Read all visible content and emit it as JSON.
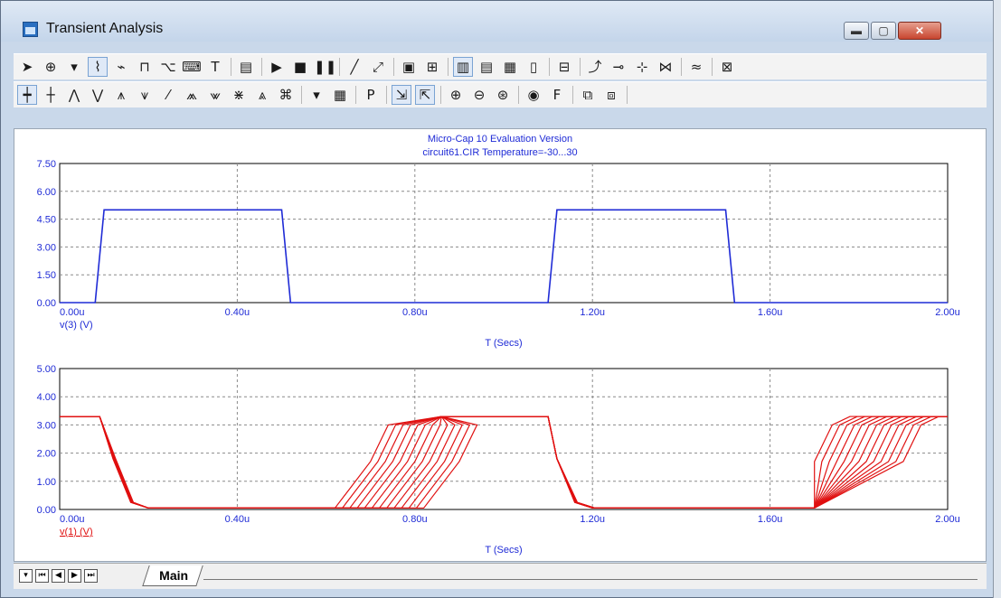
{
  "window": {
    "title": "Transient Analysis",
    "controls": {
      "minimize": "▬",
      "maximize": "▢",
      "close": "✕"
    }
  },
  "toolbar1": [
    {
      "name": "select-arrow-icon",
      "glyph": "➤"
    },
    {
      "name": "component-icon",
      "glyph": "⊕"
    },
    {
      "name": "dropdown-icon",
      "glyph": "▾"
    },
    {
      "name": "analysis-icon",
      "glyph": "⌇"
    },
    {
      "name": "wire-icon",
      "glyph": "⌁"
    },
    {
      "name": "scope-icon",
      "glyph": "⊓"
    },
    {
      "name": "probe-icon",
      "glyph": "⌥"
    },
    {
      "name": "rename-icon",
      "glyph": "⌨"
    },
    {
      "name": "text-tool-icon",
      "glyph": "T"
    },
    {
      "name": "properties-icon",
      "glyph": "▤"
    },
    {
      "name": "run-icon",
      "glyph": "▶"
    },
    {
      "name": "stop-icon",
      "glyph": "■"
    },
    {
      "name": "pause-icon",
      "glyph": "❚❚"
    },
    {
      "name": "line-icon",
      "glyph": "╱"
    },
    {
      "name": "diagonal-icon",
      "glyph": "⤢"
    },
    {
      "name": "box-icon",
      "glyph": "▣"
    },
    {
      "name": "grid-icon",
      "glyph": "⊞"
    },
    {
      "name": "vertical-bars-icon",
      "glyph": "▥"
    },
    {
      "name": "horizontal-bars-icon",
      "glyph": "▤"
    },
    {
      "name": "panel-icon",
      "glyph": "▦"
    },
    {
      "name": "columns-icon",
      "glyph": "▯"
    },
    {
      "name": "split-icon",
      "glyph": "⊟"
    },
    {
      "name": "curve-icon",
      "glyph": "⤴"
    },
    {
      "name": "cursor-left-icon",
      "glyph": "⊸"
    },
    {
      "name": "cursor-right-icon",
      "glyph": "⊹"
    },
    {
      "name": "cursor-both-icon",
      "glyph": "⋈"
    },
    {
      "name": "wave-icon",
      "glyph": "≈"
    },
    {
      "name": "chart-icon",
      "glyph": "⊠"
    }
  ],
  "toolbar2": [
    {
      "name": "crosshair-icon",
      "glyph": "┿"
    },
    {
      "name": "next-point-icon",
      "glyph": "┼"
    },
    {
      "name": "peak-icon",
      "glyph": "⋀"
    },
    {
      "name": "valley-icon",
      "glyph": "⋁"
    },
    {
      "name": "high-icon",
      "glyph": "⩚"
    },
    {
      "name": "low-icon",
      "glyph": "⩛"
    },
    {
      "name": "slope-icon",
      "glyph": "⁄"
    },
    {
      "name": "inflection-icon",
      "glyph": "⩕"
    },
    {
      "name": "global-high-icon",
      "glyph": "⩖"
    },
    {
      "name": "global-low-icon",
      "glyph": "⋇"
    },
    {
      "name": "top-icon",
      "glyph": "⩓"
    },
    {
      "name": "tag-icon",
      "glyph": "⌘"
    },
    {
      "name": "tag-dropdown-icon",
      "glyph": "▾"
    },
    {
      "name": "table-icon",
      "glyph": "▦"
    },
    {
      "name": "p-icon",
      "glyph": "P"
    },
    {
      "name": "scale-x-icon",
      "glyph": "⇲"
    },
    {
      "name": "scale-y-icon",
      "glyph": "⇱"
    },
    {
      "name": "zoom-in-icon",
      "glyph": "⊕"
    },
    {
      "name": "zoom-out-icon",
      "glyph": "⊖"
    },
    {
      "name": "zoom-fit-icon",
      "glyph": "⊛"
    },
    {
      "name": "color-icon",
      "glyph": "◉"
    },
    {
      "name": "font-icon",
      "glyph": "F"
    },
    {
      "name": "copy-icon",
      "glyph": "⧉"
    },
    {
      "name": "paste-icon",
      "glyph": "⧈"
    }
  ],
  "tabs": {
    "main": "Main"
  },
  "nav": {
    "first": "⏮",
    "prev": "◀",
    "next": "▶",
    "last": "⏭",
    "menu": "▾"
  },
  "colors": {
    "top_trace": "#1f2bd6",
    "bottom_trace": "#e01010",
    "axis_text": "#1f2bd6",
    "grid": "#8a8a8a"
  },
  "chart_data": [
    {
      "type": "line",
      "title": "Micro-Cap 10 Evaluation Version",
      "subtitle": "circuit61.CIR Temperature=-30...30",
      "xlabel": "T (Secs)",
      "ylabel": "v(3) (V)",
      "xlim": [
        0,
        2.0
      ],
      "ylim": [
        0,
        7.5
      ],
      "x_unit_suffix": "u",
      "xticks": [
        "0.00u",
        "0.40u",
        "0.80u",
        "1.20u",
        "1.60u",
        "2.00u"
      ],
      "yticks": [
        "0.00",
        "1.50",
        "3.00",
        "4.50",
        "6.00",
        "7.50"
      ],
      "grid": true,
      "series": [
        {
          "name": "v(3) (V)",
          "x": [
            0,
            0.08,
            0.1,
            0.5,
            0.52,
            1.1,
            1.12,
            1.5,
            1.52,
            2.0
          ],
          "y": [
            0,
            0,
            5,
            5,
            0,
            0,
            5,
            5,
            0,
            0
          ]
        }
      ]
    },
    {
      "type": "line",
      "xlabel": "T (Secs)",
      "ylabel": "v(1) (V)",
      "xlim": [
        0,
        2.0
      ],
      "ylim": [
        0,
        5.0
      ],
      "x_unit_suffix": "u",
      "xticks": [
        "0.00u",
        "0.40u",
        "0.80u",
        "1.20u",
        "1.60u",
        "2.00u"
      ],
      "yticks": [
        "0.00",
        "1.00",
        "2.00",
        "3.00",
        "4.00",
        "5.00"
      ],
      "grid": true,
      "temperature_sweep_count": 13,
      "series": [
        {
          "name": "v(1) (V)",
          "x": [
            0,
            0.09,
            0.12,
            0.16,
            0.2,
            0.7,
            0.78,
            0.82,
            0.86,
            1.1,
            1.12,
            1.16,
            1.2,
            1.7,
            1.78,
            1.82,
            1.86,
            2.0
          ],
          "y": [
            3.3,
            3.3,
            1.8,
            0.25,
            0.05,
            0.05,
            1.7,
            3.0,
            3.3,
            3.3,
            1.8,
            0.25,
            0.05,
            0.05,
            1.7,
            3.0,
            3.3,
            3.3
          ]
        }
      ],
      "rise_spread_low": [
        0.62,
        1.62
      ],
      "rise_spread_high": [
        0.82,
        1.82
      ]
    }
  ]
}
